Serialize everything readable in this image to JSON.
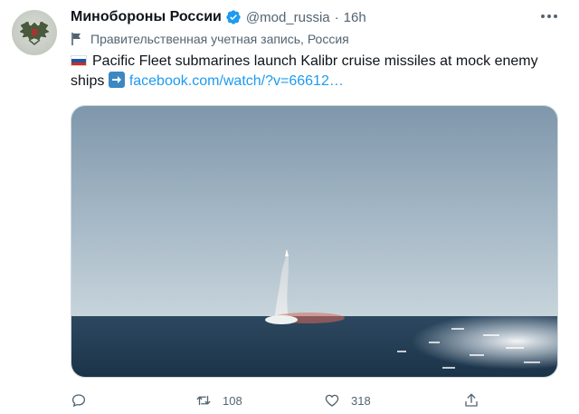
{
  "tweet": {
    "author": {
      "display_name": "Минобороны России",
      "handle": "@mod_russia",
      "separator": "·",
      "timestamp": "16h",
      "verified": true,
      "avatar_icon": "double-headed-eagle-emblem"
    },
    "account_label": "Правительственная учетная запись, Россия",
    "text_line1": "Pacific Fleet submarines launch Kalibr cruise missiles at mock enemy",
    "text_line2_prefix": "ships",
    "link_text": "facebook.com/watch/?v=66612…",
    "emoji": [
      "russia-flag-emoji",
      "right-arrow-emoji"
    ],
    "actions": {
      "reply_count": "",
      "retweet_count": "108",
      "like_count": "318"
    },
    "colors": {
      "link": "#1d9bf0",
      "verified": "#1d9bf0",
      "secondary_text": "#536471"
    }
  }
}
